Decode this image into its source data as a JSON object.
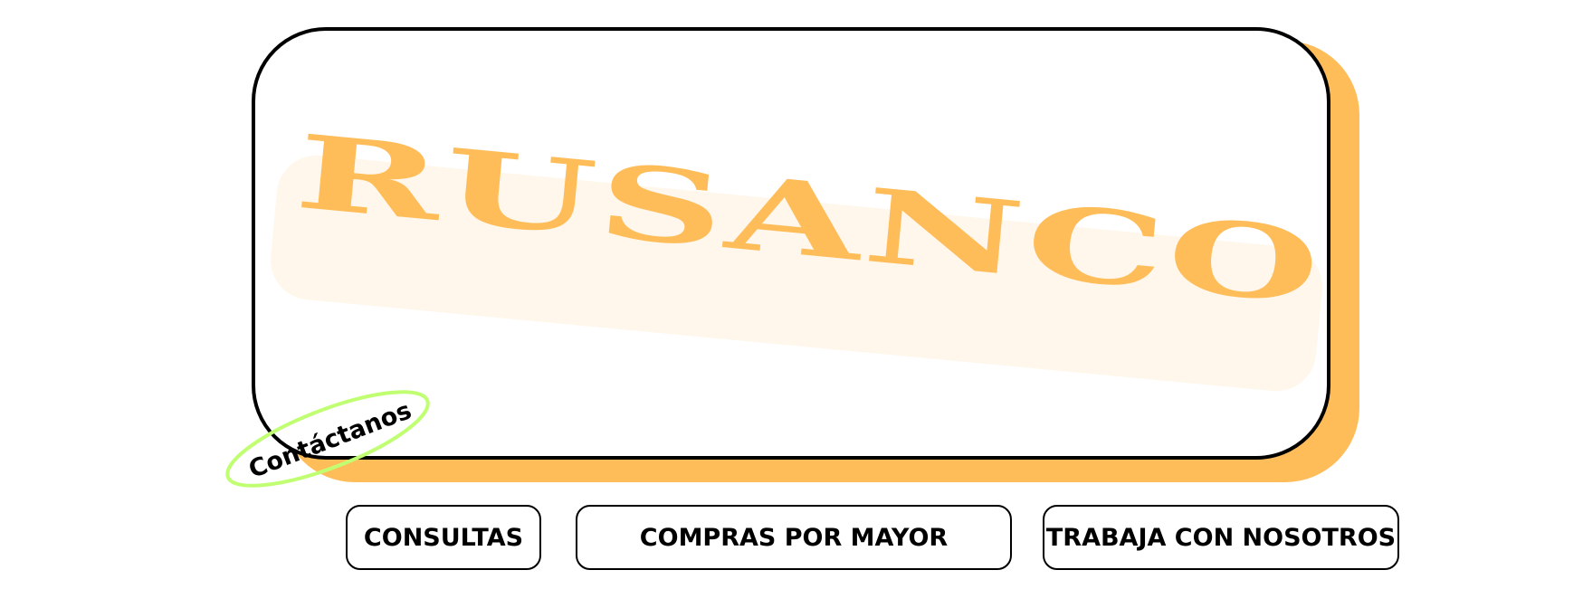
{
  "brand": {
    "name": "RUSANCO",
    "color": "#ffbd59",
    "banner_color": "#fff7ec"
  },
  "contact": {
    "label": "Contáctanos",
    "ring_color": "#c1ff72"
  },
  "nav": {
    "consultas_label": "CONSULTAS",
    "compras_label": "COMPRAS POR MAYOR",
    "trabaja_label": "TRABAJA CON NOSOTROS"
  },
  "colors": {
    "accent": "#ffbd59",
    "outline": "#000000",
    "background": "#ffffff"
  }
}
